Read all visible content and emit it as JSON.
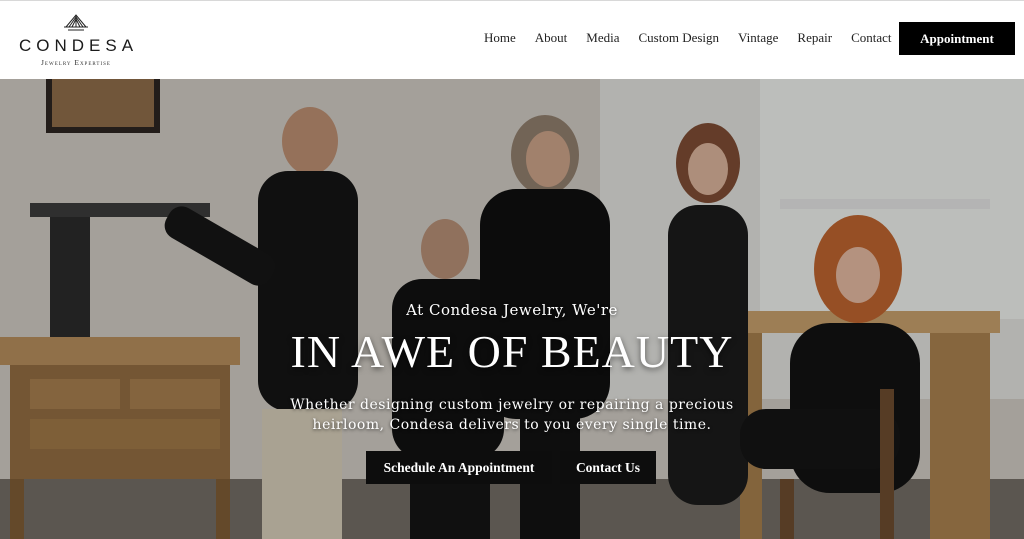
{
  "brand": {
    "name": "CONDESA",
    "tagline": "Jewelry Expertise"
  },
  "nav": {
    "items": [
      "Home",
      "About",
      "Media",
      "Custom Design",
      "Vintage",
      "Repair",
      "Contact"
    ],
    "cta_label": "Appointment"
  },
  "hero": {
    "eyebrow": "At Condesa Jewelry, We're",
    "title": "IN AWE OF BEAUTY",
    "description": "Whether designing custom jewelry or repairing a precious heirloom, Condesa delivers to you every single time.",
    "buttons": {
      "primary": "Schedule An Appointment",
      "secondary": "Contact Us"
    }
  },
  "colors": {
    "header_bg": "#ffffff",
    "button_bg": "#000000",
    "button_text": "#ffffff",
    "hero_text": "#ffffff"
  }
}
